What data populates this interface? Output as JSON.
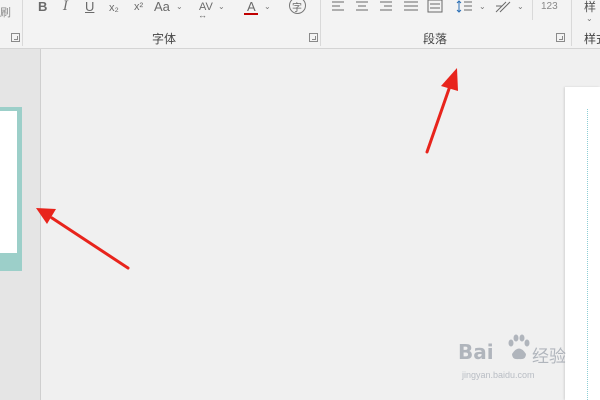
{
  "ribbon": {
    "groups": [
      {
        "label": "字体"
      },
      {
        "label": "段落"
      },
      {
        "label": "样式"
      }
    ],
    "font_buttons": {
      "partial_left": "刷",
      "bold": "B",
      "italic": "I",
      "underline": "U",
      "subscript": "x₂",
      "superscript": "x²",
      "change_case": "Aa",
      "char_spacing": "AV",
      "font_color": "A",
      "phonetic": "字"
    },
    "paragraph_buttons": {
      "text_direction": "123"
    },
    "styles_partial": "样"
  },
  "colors": {
    "arrow": "#e8241c",
    "thumbnail_selected": "#9ccfc9",
    "font_color_underline": "#c00000"
  },
  "watermark": {
    "logo": "Bai",
    "brand_cn": "经验",
    "url": "jingyan.baidu.com"
  }
}
